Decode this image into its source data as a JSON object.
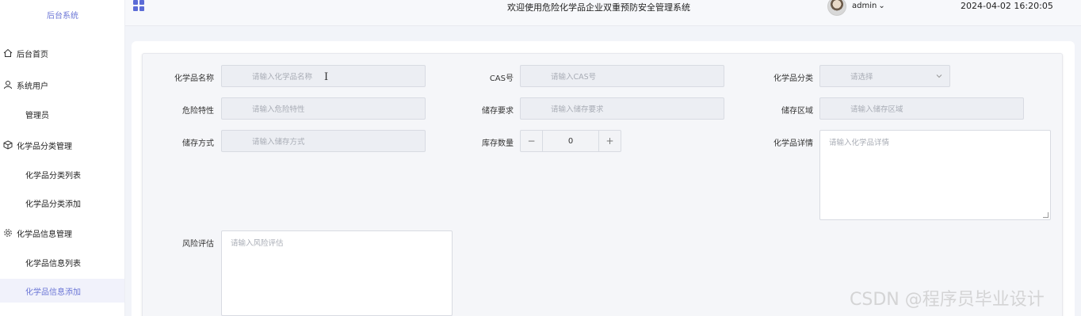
{
  "sidebar": {
    "title": "后台系统",
    "items": [
      {
        "label": "后台首页",
        "icon": "home-icon"
      },
      {
        "label": "系统用户",
        "icon": "user-icon"
      },
      {
        "label": "管理员"
      },
      {
        "label": "化学品分类管理",
        "icon": "cube-icon"
      },
      {
        "label": "化学品分类列表"
      },
      {
        "label": "化学品分类添加"
      },
      {
        "label": "化学品信息管理",
        "icon": "gear-icon"
      },
      {
        "label": "化学品信息列表"
      },
      {
        "label": "化学品信息添加"
      }
    ]
  },
  "header": {
    "title": "欢迎使用危险化学品企业双重预防安全管理系统",
    "user": "admin",
    "datetime": "2024-04-02 16:20:05"
  },
  "form": {
    "name": {
      "label": "化学品名称",
      "placeholder": "请输入化学品名称"
    },
    "cas": {
      "label": "CAS号",
      "placeholder": "请输入CAS号"
    },
    "category": {
      "label": "化学品分类",
      "placeholder": "请选择"
    },
    "hazard": {
      "label": "危险特性",
      "placeholder": "请输入危险特性"
    },
    "storage_req": {
      "label": "储存要求",
      "placeholder": "请输入储存要求"
    },
    "storage_area": {
      "label": "储存区域",
      "placeholder": "请输入储存区域"
    },
    "storage_method": {
      "label": "储存方式",
      "placeholder": "请输入储存方式"
    },
    "stock": {
      "label": "库存数量",
      "value": "0",
      "minus": "−",
      "plus": "+"
    },
    "detail": {
      "label": "化学品详情",
      "placeholder": "请输入化学品详情"
    },
    "risk": {
      "label": "风险评估",
      "placeholder": "请输入风险评估"
    }
  },
  "watermark": "CSDN @程序员毕业设计",
  "colors": {
    "accent": "#6b76d6",
    "grid_icon": "#5b6bd6"
  }
}
